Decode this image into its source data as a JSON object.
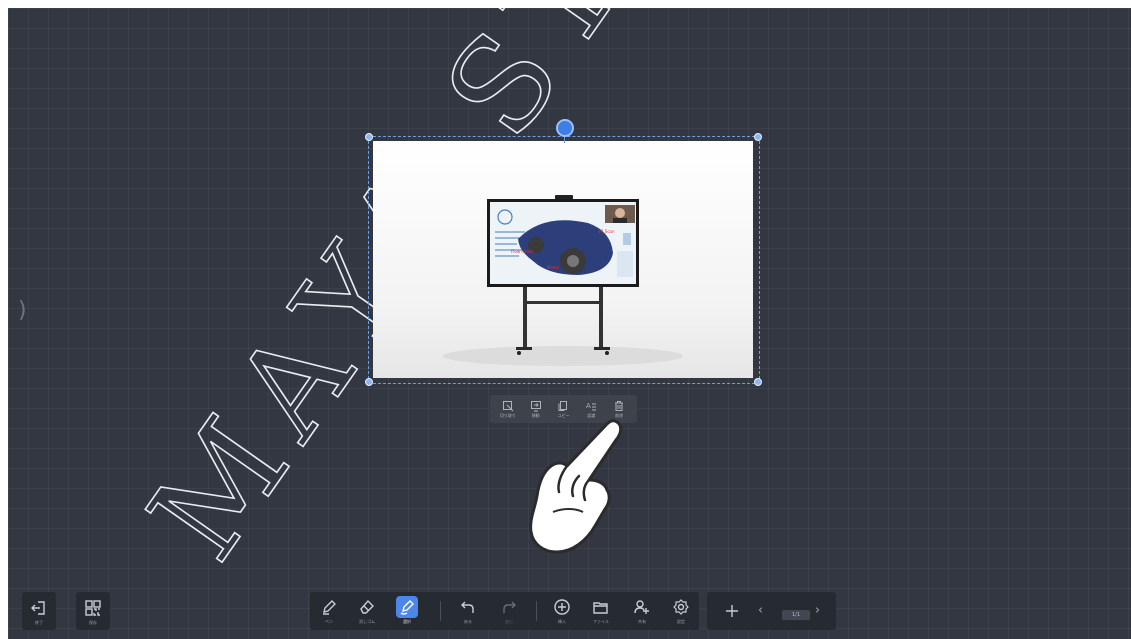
{
  "context_menu": {
    "items": [
      {
        "label": "切り取り",
        "icon": "crop-icon"
      },
      {
        "label": "移動",
        "icon": "move-screen-icon"
      },
      {
        "label": "コピー",
        "icon": "copy-icon"
      },
      {
        "label": "認識",
        "icon": "recognize-text-icon"
      },
      {
        "label": "削除",
        "icon": "trash-icon"
      }
    ]
  },
  "left_tools": {
    "exit_label": "終了",
    "save_label": "保存"
  },
  "toolbar": {
    "pen_label": "ペン",
    "eraser_label": "消しゴム",
    "select_label": "選択",
    "undo_label": "戻る",
    "redo_label": "進む",
    "insert_label": "挿入",
    "file_label": "ファイル",
    "share_label": "共有",
    "settings_label": "設定"
  },
  "pager": {
    "page_indicator": "1/1"
  },
  "watermark": {
    "text": "MAYA SYS"
  },
  "colors": {
    "canvas": "#323741",
    "accent": "#4d86ea",
    "selection": "#6a9ee8"
  }
}
